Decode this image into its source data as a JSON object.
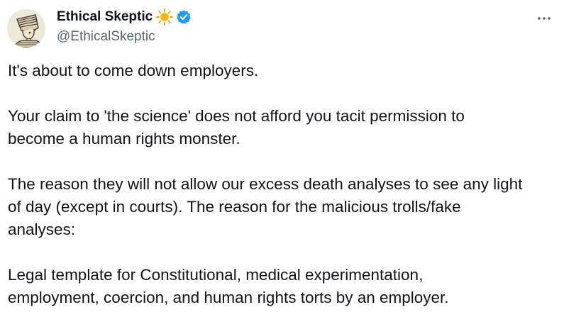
{
  "author": {
    "display_name": "Ethical Skeptic",
    "handle": "@EthicalSkeptic",
    "name_emoji_icon": "sun-icon",
    "verified_icon": "verified-badge-icon",
    "avatar_icon": "pharaoh-sketch-avatar"
  },
  "menu": {
    "more_icon": "more-options-icon",
    "more_glyph": "···"
  },
  "tweet": {
    "paragraphs": [
      "It's about to come down employers.",
      "Your claim to 'the science' does not afford you tacit permission to\nbecome a human rights monster.",
      "The reason they will not allow our excess death analyses to see any light\nof day (except in courts). The reason for the malicious trolls/fake\nanalyses:",
      "Legal template for Constitutional, medical experimentation,\nemployment, coercion, and human rights torts by an employer."
    ]
  },
  "colors": {
    "text": "#0f1419",
    "secondary": "#536471",
    "verified": "#1d9bf0",
    "sun": "#f7a800"
  }
}
